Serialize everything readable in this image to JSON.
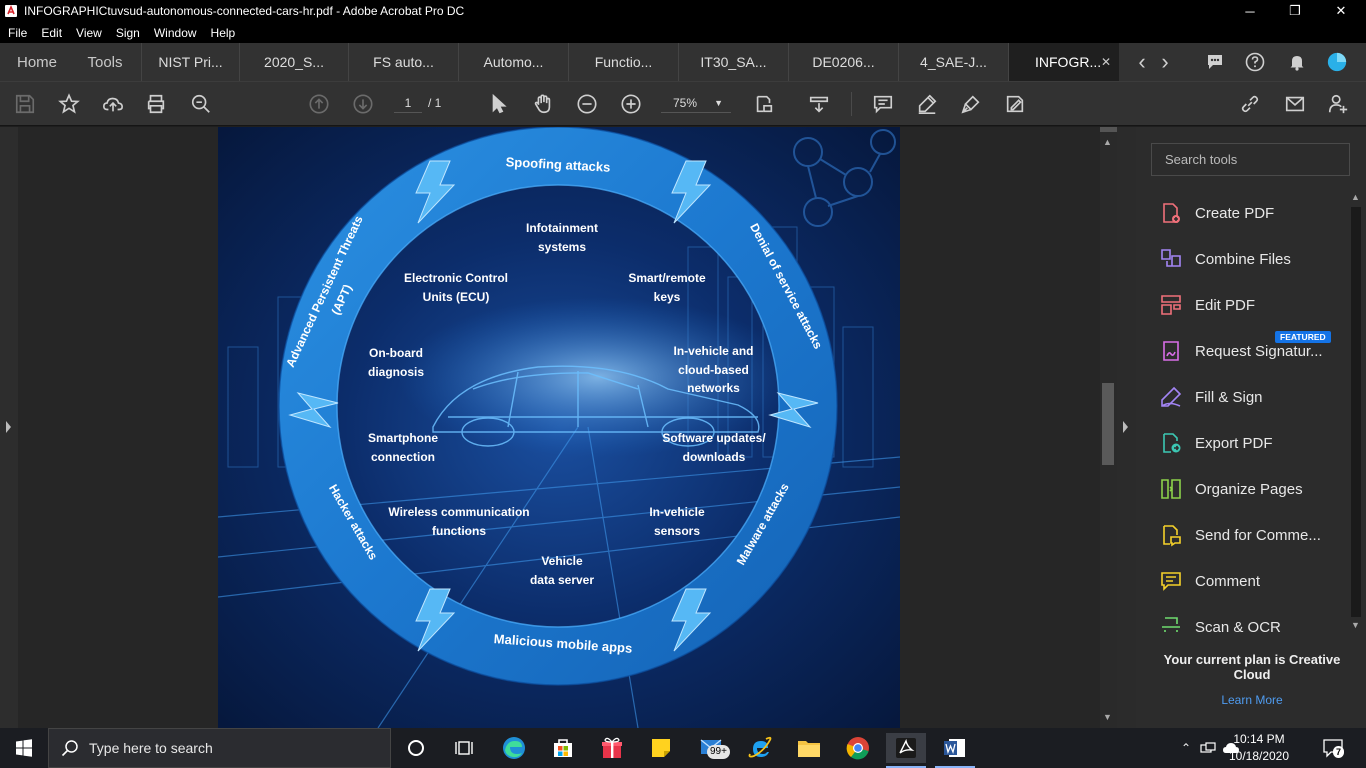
{
  "window": {
    "title": "INFOGRAPHICtuvsud-autonomous-connected-cars-hr.pdf - Adobe Acrobat Pro DC",
    "controls": {
      "minimize": "─",
      "restore": "❐",
      "close": "✕"
    }
  },
  "menu": [
    "File",
    "Edit",
    "View",
    "Sign",
    "Window",
    "Help"
  ],
  "tabs": {
    "home": "Home",
    "tools": "Tools",
    "documents": [
      "NIST Pri...",
      "2020_S...",
      "FS auto...",
      "Automo...",
      "Functio...",
      "IT30_SA...",
      "DE0206...",
      "4_SAE-J...",
      "INFOGR..."
    ],
    "close_symbol": "✕",
    "nav_prev": "‹",
    "nav_next": "›"
  },
  "toolbar": {
    "page_current": "1",
    "page_total": "/ 1",
    "zoom": "75%",
    "zoom_caret": "▼"
  },
  "infographic": {
    "ring_labels": {
      "top": "Spoofing attacks",
      "upper_right": "Denial of service attacks",
      "lower_right": "Malware attacks",
      "bottom": "Malicious mobile apps",
      "lower_left": "Hacker attacks",
      "upper_left": "Advanced Persistent Threats (APT)"
    },
    "inner_labels": {
      "infotainment": "Infotainment\nsystems",
      "ecu": "Electronic Control\nUnits (ECU)",
      "smart_keys": "Smart/remote\nkeys",
      "onboard": "On-board\ndiagnosis",
      "networks": "In-vehicle and\ncloud-based\nnetworks",
      "smartphone": "Smartphone\nconnection",
      "software": "Software updates/\ndownloads",
      "wireless": "Wireless communication\nfunctions",
      "sensors": "In-vehicle\nsensors",
      "data_server": "Vehicle\ndata server"
    }
  },
  "tools_pane": {
    "search_placeholder": "Search tools",
    "featured_badge": "FEATURED",
    "items": [
      {
        "label": "Create PDF",
        "color": "#f0707a"
      },
      {
        "label": "Combine Files",
        "color": "#a385f5"
      },
      {
        "label": "Edit PDF",
        "color": "#f0707a"
      },
      {
        "label": "Request Signatur...",
        "color": "#d96ee8"
      },
      {
        "label": "Fill & Sign",
        "color": "#a385f5"
      },
      {
        "label": "Export PDF",
        "color": "#3cc8b4"
      },
      {
        "label": "Organize Pages",
        "color": "#8cd24a"
      },
      {
        "label": "Send for Comme...",
        "color": "#f5d12a"
      },
      {
        "label": "Comment",
        "color": "#f5d12a"
      },
      {
        "label": "Scan & OCR",
        "color": "#6fdc6f"
      }
    ],
    "plan_text": "Your current plan is Creative Cloud",
    "learn_more": "Learn More"
  },
  "taskbar": {
    "search_placeholder": "Type here to search",
    "mail_badge": "99+",
    "time": "10:14 PM",
    "date": "10/18/2020",
    "notification_count": "7"
  }
}
